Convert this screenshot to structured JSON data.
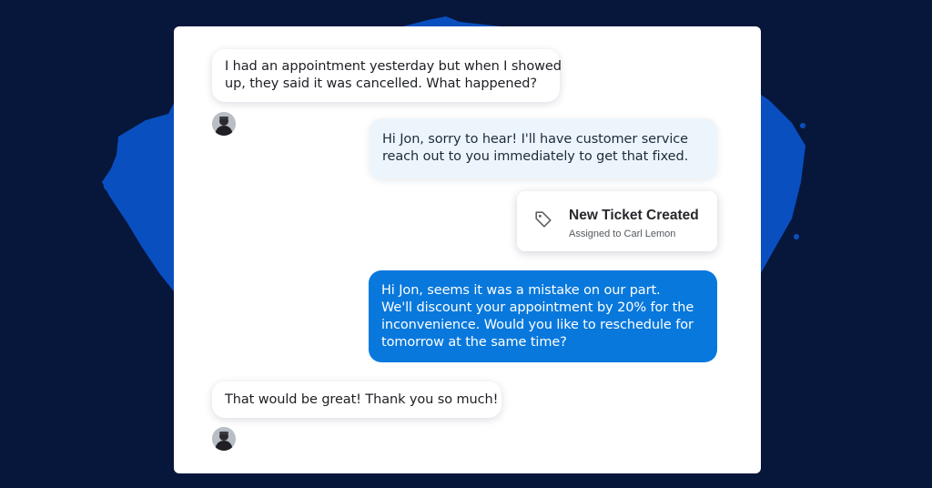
{
  "chat": {
    "messages": [
      {
        "role": "customer",
        "lines": [
          "I had an appointment yesterday but when I showed",
          "up, they said it was cancelled. What happened?"
        ]
      },
      {
        "role": "agent",
        "lines": [
          "Hi Jon, sorry to hear! I'll have customer service",
          "reach out to you immediately to get that fixed."
        ]
      },
      {
        "role": "agent",
        "lines": [
          "Hi Jon, seems it was a mistake on our part.",
          "We'll discount your appointment by 20% for the",
          "inconvenience. Would you like to reschedule for",
          "tomorrow at the same time?"
        ]
      },
      {
        "role": "customer",
        "lines": [
          "That would be great! Thank you so much!"
        ]
      }
    ],
    "ticket": {
      "title": "New Ticket Created",
      "subtitle": "Assigned to Carl Lemon",
      "icon": "tag-icon"
    }
  },
  "colors": {
    "background": "#07163b",
    "splash": "#0a4fc0",
    "agent_bubble_light": "#edf5fc",
    "agent_bubble_blue": "#0878dc",
    "customer_bubble": "#ffffff"
  }
}
